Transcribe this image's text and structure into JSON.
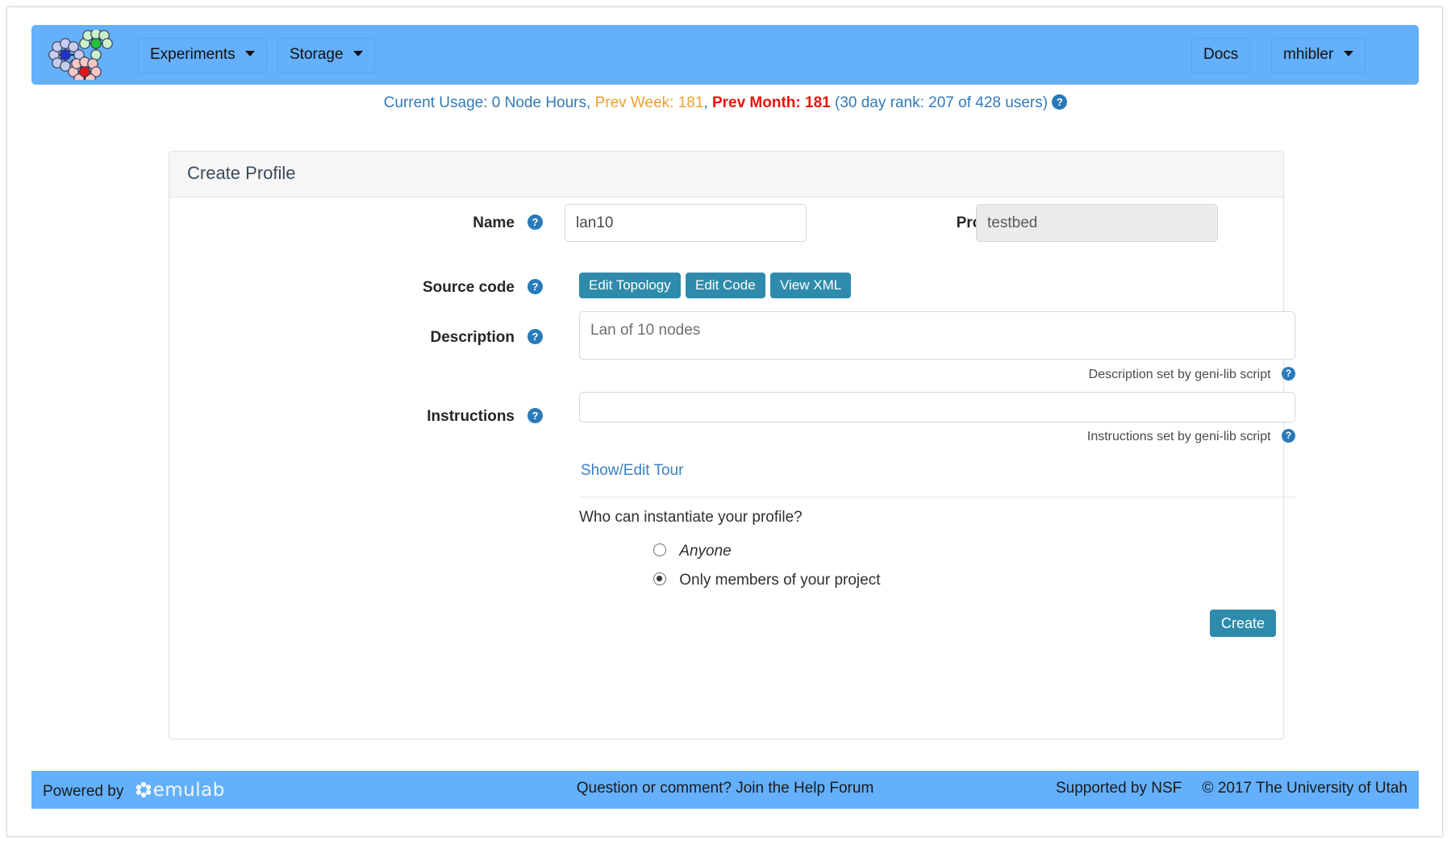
{
  "navbar": {
    "logo_icon": "emulab-cluster-logo",
    "items": [
      {
        "label": "Experiments",
        "caret": true,
        "name": "nav-experiments"
      },
      {
        "label": "Storage",
        "caret": true,
        "name": "nav-storage"
      }
    ],
    "right_items": [
      {
        "label": "Docs",
        "caret": false,
        "name": "nav-docs"
      },
      {
        "label": "mhibler",
        "caret": true,
        "name": "nav-user"
      }
    ]
  },
  "usage": {
    "current_label": "Current Usage: 0 Node Hours,",
    "prev_week": "Prev Week: 181",
    "comma": ",",
    "prev_month": "Prev Month: 181",
    "rank": "(30 day rank: 207 of 428 users)",
    "help_icon": "question-mark-icon",
    "colors": {
      "link_blue": "#337ab7",
      "orange": "#f0a030",
      "red": "#e8140f"
    }
  },
  "panel": {
    "title": "Create Profile"
  },
  "form": {
    "name": {
      "label": "Name",
      "value": "lan10",
      "placeholder": "",
      "help_icon": "question-mark-icon"
    },
    "project": {
      "label": "Project",
      "value": "testbed",
      "disabled": true
    },
    "source_code": {
      "label": "Source code",
      "help_icon": "question-mark-icon",
      "buttons": [
        {
          "label": "Edit Topology"
        },
        {
          "label": "Edit Code"
        },
        {
          "label": "View XML"
        }
      ]
    },
    "description": {
      "label": "Description",
      "value": "Lan of 10 nodes",
      "help_icon": "question-mark-icon",
      "note": "Description set by geni-lib script",
      "note_help_icon": "question-mark-icon"
    },
    "instructions": {
      "label": "Instructions",
      "value": "",
      "placeholder": "",
      "help_icon": "question-mark-icon",
      "note": "Instructions set by geni-lib script",
      "note_help_icon": "question-mark-icon"
    },
    "tour": {
      "link_label": "Show/Edit Tour"
    },
    "permissions": {
      "question": "Who can instantiate your profile?",
      "options": [
        {
          "label": "Anyone",
          "selected": false,
          "italic": true
        },
        {
          "label": "Only members of your project",
          "selected": true,
          "italic": false
        }
      ]
    },
    "submit": {
      "label": "Create"
    }
  },
  "footer": {
    "powered_by": "Powered by",
    "wordmark": "emulab",
    "flower_icon": "emulab-flower-icon",
    "help_forum": "Question or comment? Join the Help Forum",
    "nsf": "Supported by NSF",
    "copyright": "© 2017 The University of Utah"
  },
  "theme": {
    "navbar_blue": "#64b0fc",
    "teal_button": "#2e8bab",
    "panel_heading": "#f6f6f6"
  }
}
